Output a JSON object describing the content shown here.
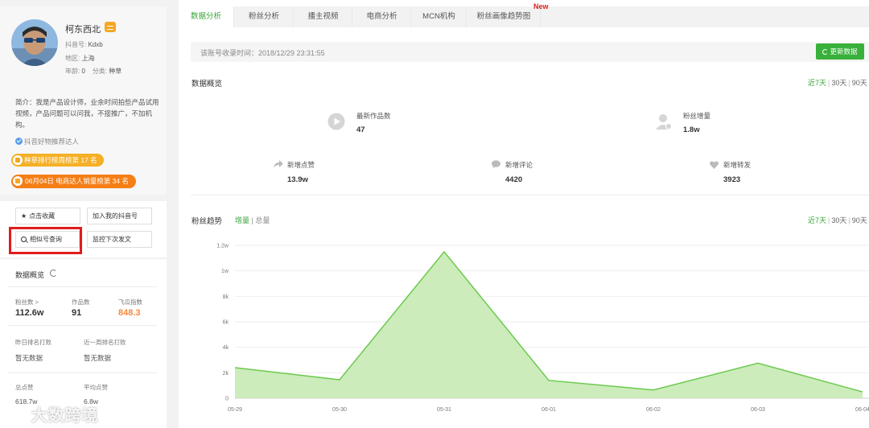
{
  "profile": {
    "name": "柯东西北",
    "douyin_id_label": "抖音号:",
    "douyin_id": "Kdxb",
    "region_label": "地区:",
    "region": "上海",
    "age_label": "年龄:",
    "age": "0",
    "category_label": "分类:",
    "category": "种草",
    "bio": "简介：我是产品设计师，业余时间拍些产品试用视频，产品问题可以问我，不接推广，不加机构。",
    "verified_text": "抖音好物推荐达人",
    "rank_badge_1": "种草排行榜周榜第 17 名",
    "rank_badge_2": "06月04日 电商达人销量榜第 34 名"
  },
  "actions": {
    "favorite": "点击收藏",
    "add_mine": "加入我的抖音号",
    "similar": "相似号查询",
    "monitor": "监控下次发文"
  },
  "overview": {
    "title": "数据概览",
    "fans_label": "粉丝数 >",
    "fans_value": "112.6w",
    "works_label": "作品数",
    "works_value": "91",
    "index_label": "飞瓜指数",
    "index_value": "848.3",
    "yesterday_label": "昨日排名打败",
    "yesterday_value": "暂无数据",
    "week_label": "近一周排名打败",
    "week_value": "暂无数据",
    "total_likes_label": "总点赞",
    "total_likes_value": "618.7w",
    "avg_likes_label": "平均点赞",
    "avg_likes_value": "6.8w"
  },
  "watermark": "大数跨境",
  "tabs": [
    {
      "label": "数据分析"
    },
    {
      "label": "粉丝分析"
    },
    {
      "label": "播主视频"
    },
    {
      "label": "电商分析"
    },
    {
      "label": "MCN机构"
    },
    {
      "label": "粉丝画像趋势图"
    }
  ],
  "new_badge": "New",
  "record": {
    "text": "该账号收录时间：2018/12/29 23:31:55",
    "update_button": "更新数据"
  },
  "data_overview": {
    "title": "数据概览",
    "range": {
      "d7": "近7天",
      "d30": "30天",
      "d90": "90天"
    },
    "stats": [
      {
        "label": "最新作品数",
        "value": "47",
        "icon": "play-icon"
      },
      {
        "label": "粉丝增量",
        "value": "1.8w",
        "icon": "user-icon"
      },
      {
        "label": "新增点赞",
        "value": "13.9w",
        "icon": "share-icon"
      },
      {
        "label": "新增评论",
        "value": "4420",
        "icon": "comment-icon"
      },
      {
        "label": "新增转发",
        "value": "3923",
        "icon": "heart-icon"
      }
    ]
  },
  "trend": {
    "title": "粉丝趋势",
    "toggle_increment": "增量",
    "toggle_sep": "|",
    "toggle_total": "总量",
    "range": {
      "d7": "近7天",
      "d30": "30天",
      "d90": "90天"
    }
  },
  "colors": {
    "accent": "#3aa43a",
    "line": "#6cc94e",
    "fill": "#c6eab4",
    "orange": "#f5883b",
    "highlight_border": "#e01c1c"
  },
  "chart_data": {
    "type": "area",
    "title": "",
    "x": [
      "05-29",
      "05-30",
      "05-31",
      "06-01",
      "06-02",
      "06-03",
      "06-04"
    ],
    "y_ticks": [
      "0",
      "2k",
      "4k",
      "6k",
      "8k",
      "1w",
      "1.2w"
    ],
    "series": [
      {
        "values": [
          2400,
          1450,
          11500,
          1400,
          650,
          2750,
          500
        ]
      }
    ],
    "ylim": [
      0,
      12000
    ],
    "grid": true,
    "legend": "none"
  }
}
